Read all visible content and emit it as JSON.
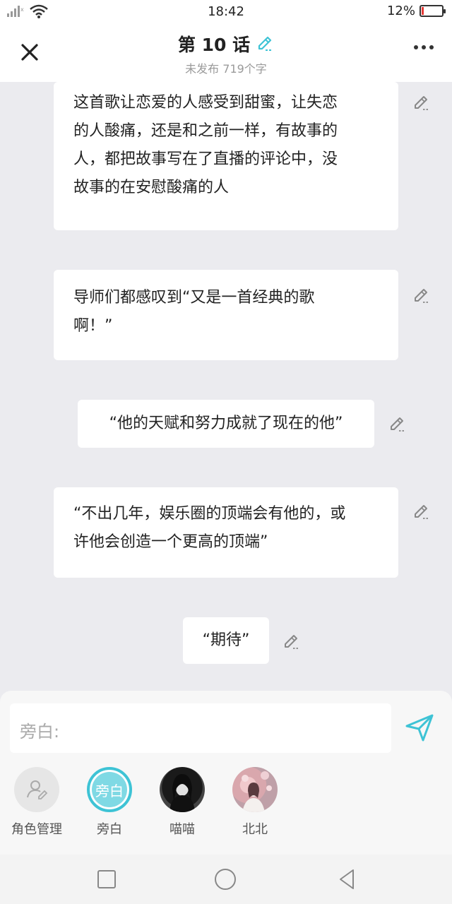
{
  "status_bar": {
    "time": "18:42",
    "battery": "12%",
    "battery_level": 0.12,
    "battery_color": "#e53935"
  },
  "header": {
    "title": "第 10 话",
    "subtitle": "未发布 719个字",
    "close_icon": "close-icon",
    "edit_icon": "pencil-icon",
    "more_icon": "more-icon",
    "accent": "#3ec3d5"
  },
  "messages": [
    {
      "lines": [
        "这首歌让恋爱的人感受到甜蜜，让失恋",
        "的人酸痛，还是和之前一样，有故事的",
        "人，都把故事写在了直播的评论中，没",
        "故事的在安慰酸痛的人"
      ]
    },
    {
      "lines": [
        "导师们都感叹到“又是一首经典的歌",
        "啊！”"
      ]
    },
    {
      "lines": [
        "“他的天赋和努力成就了现在的他”"
      ]
    },
    {
      "lines": [
        "“不出几年，娱乐圈的顶端会有他的，或",
        "许他会创造一个更高的顶端”"
      ]
    },
    {
      "lines": [
        "“期待”"
      ]
    }
  ],
  "composer": {
    "placeholder": "旁白:",
    "send_icon": "send-icon"
  },
  "roles": [
    {
      "label": "角色管理",
      "icon": "person-edit-icon"
    },
    {
      "label": "旁白",
      "avatar_text": "旁白",
      "selected": true
    },
    {
      "label": "喵喵",
      "icon": "avatar-photo"
    },
    {
      "label": "北北",
      "icon": "avatar-photo"
    }
  ],
  "navbar": {
    "icons": [
      "square-icon",
      "circle-icon",
      "triangle-back-icon"
    ]
  }
}
